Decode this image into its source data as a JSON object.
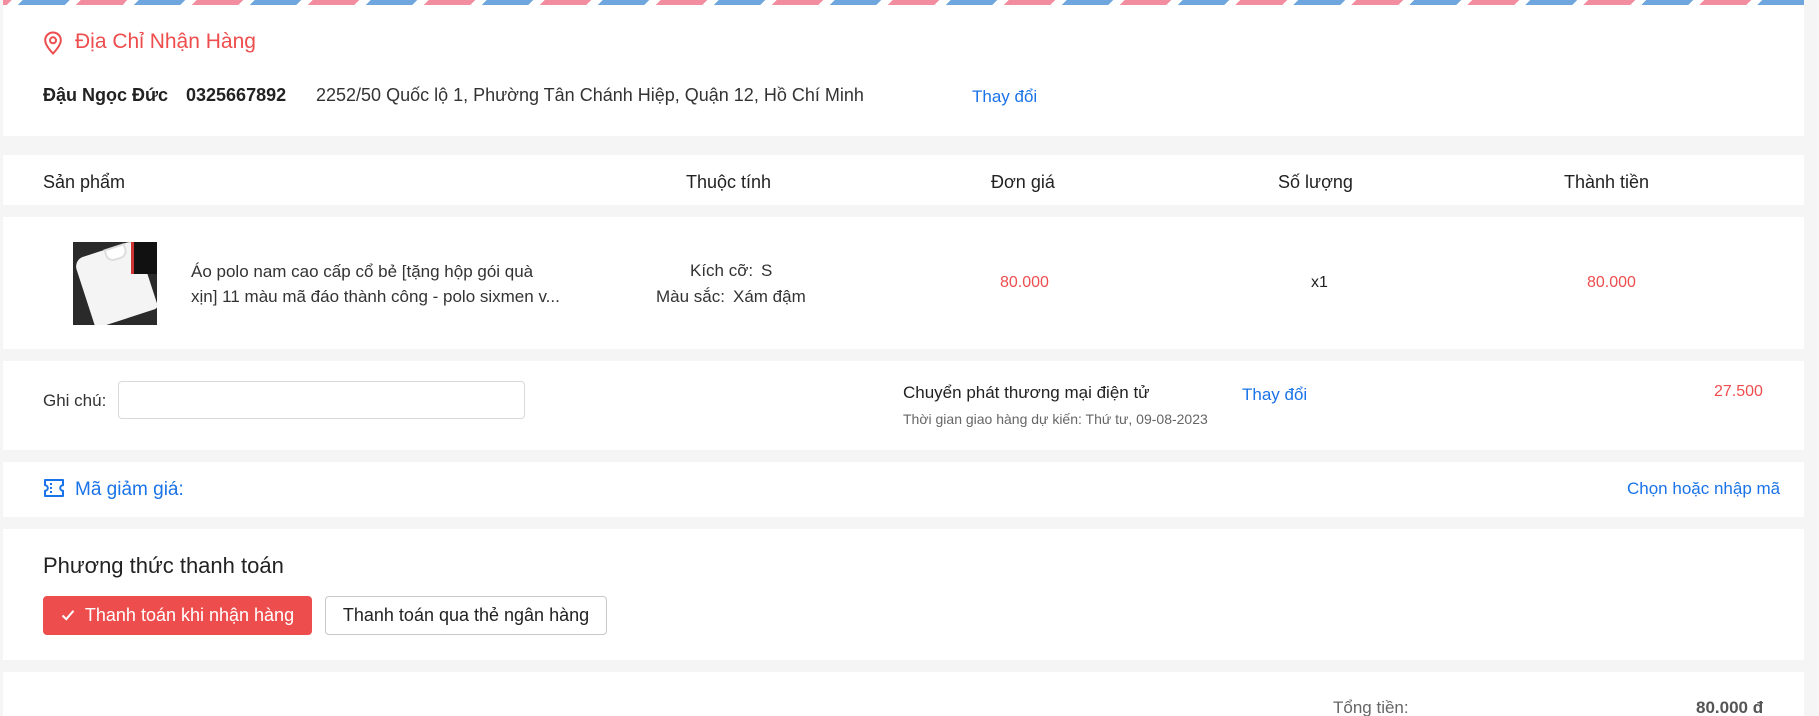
{
  "address": {
    "title": "Địa Chỉ Nhận Hàng",
    "name": "Đậu Ngọc Đức",
    "phone": "0325667892",
    "full_address": "2252/50 Quốc lộ 1, Phường Tân Chánh Hiệp, Quận 12, Hồ Chí Minh",
    "change_label": "Thay đổi",
    "icon": "location-pin-icon"
  },
  "table": {
    "headers": [
      "Sản phẩm",
      "Thuộc tính",
      "Đơn giá",
      "Số lượng",
      "Thành tiền"
    ],
    "items": [
      {
        "name_line1": "Áo polo nam cao cấp cổ bẻ [tặng hộp gói quà",
        "name_line2": "xịn] 11 màu mã đáo thành công - polo sixmen v...",
        "size_label": "Kích cỡ:",
        "size_value": "S",
        "color_label": "Màu sắc:",
        "color_value": "Xám đậm",
        "unit_price": "80.000",
        "quantity": "x1",
        "total": "80.000"
      }
    ]
  },
  "note": {
    "label": "Ghi chú:",
    "value": "",
    "placeholder": ""
  },
  "shipping": {
    "method": "Chuyển phát thương mại điện tử",
    "change_label": "Thay đổi",
    "eta": "Thời gian giao hàng dự kiến: Thứ tư, 09-08-2023",
    "fee": "27.500"
  },
  "voucher": {
    "label": "Mã giảm giá:",
    "action": "Chọn hoặc nhập mã",
    "icon": "voucher-ticket-icon"
  },
  "payment": {
    "title": "Phương thức thanh toán",
    "options": [
      {
        "label": "Thanh toán khi nhận hàng",
        "selected": true
      },
      {
        "label": "Thanh toán qua thẻ ngân hàng",
        "selected": false
      }
    ]
  },
  "summary": {
    "total_label": "Tổng tiền:",
    "total_value": "80.000 đ"
  },
  "colors": {
    "accent": "#ee4d4d",
    "link": "#1a73e8",
    "background": "#f5f5f5"
  }
}
